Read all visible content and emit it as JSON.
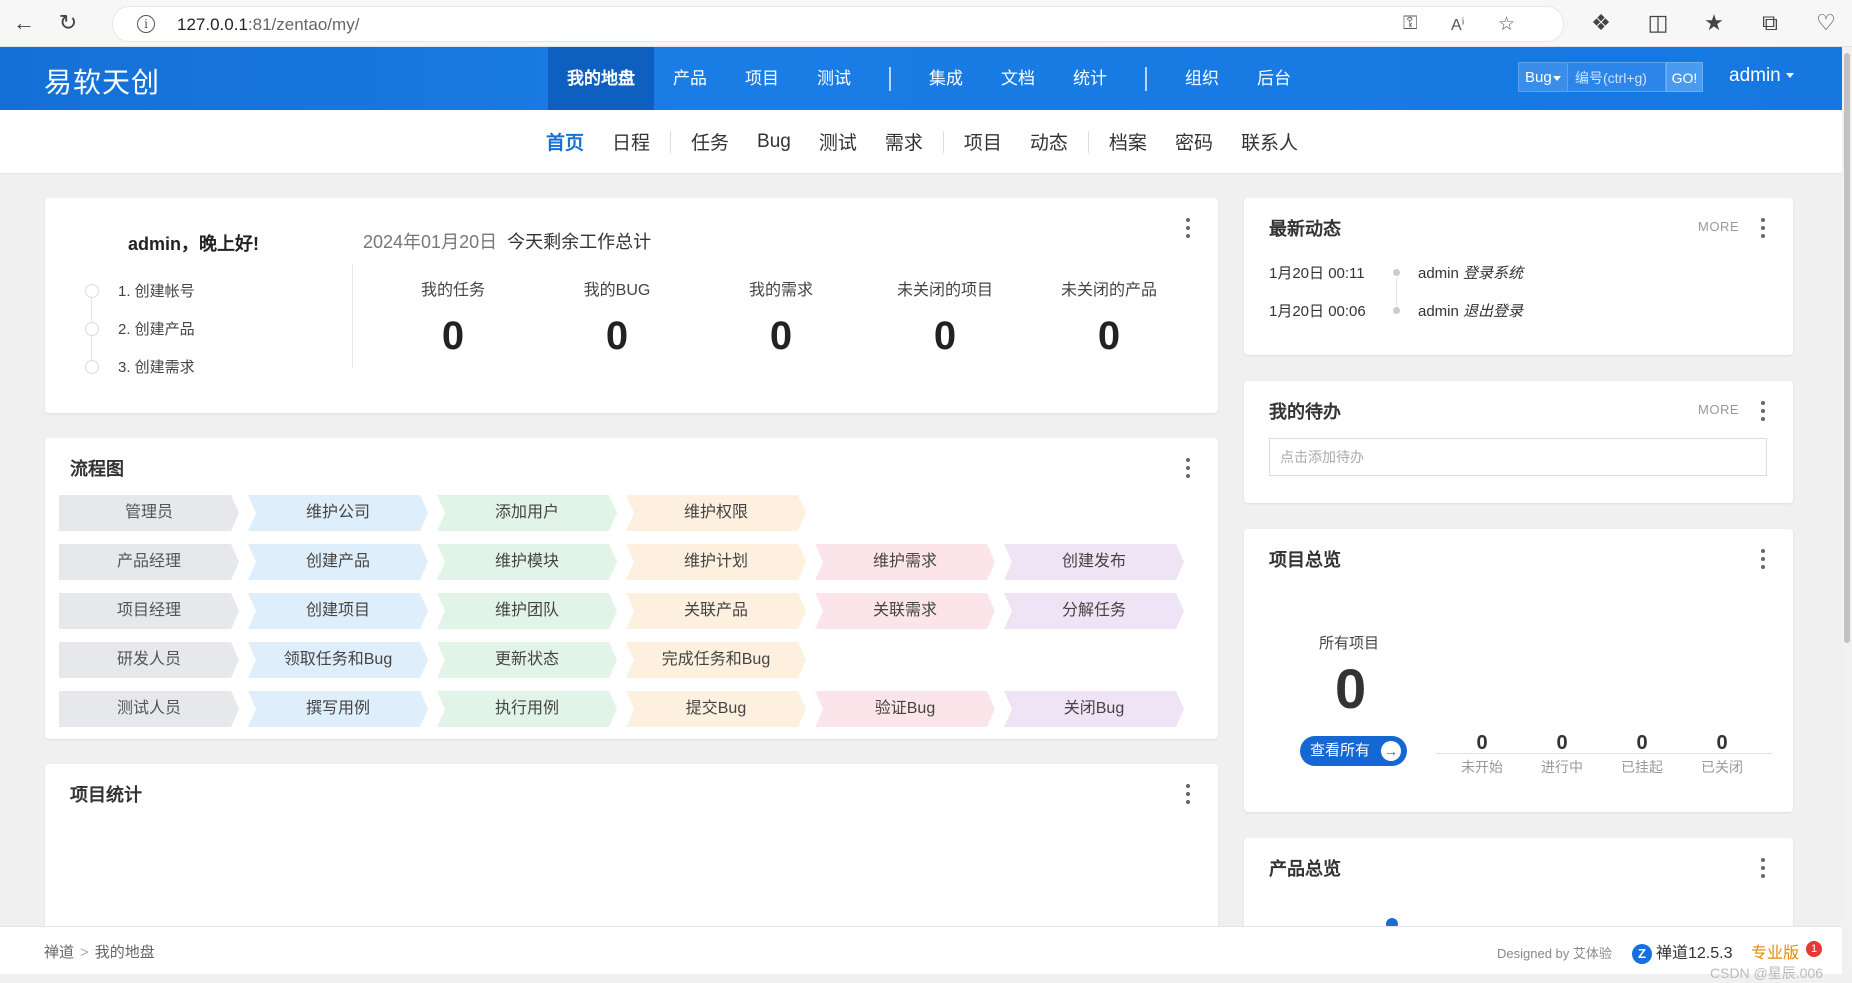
{
  "browser": {
    "url_host": "127.0.0.1",
    "url_rest": ":81/zentao/my/"
  },
  "topnav": {
    "logo": "易软天创",
    "items": [
      "我的地盘",
      "产品",
      "项目",
      "测试",
      "集成",
      "文档",
      "统计",
      "组织",
      "后台"
    ],
    "active": "我的地盘",
    "search_type": "Bug",
    "search_placeholder": "编号(ctrl+g)",
    "go_label": "GO!",
    "user": "admin"
  },
  "subnav": {
    "items": [
      "首页",
      "日程",
      "任务",
      "Bug",
      "测试",
      "需求",
      "项目",
      "动态",
      "档案",
      "密码",
      "联系人"
    ],
    "active": "首页"
  },
  "welcome": {
    "greeting": "admin，晚上好!",
    "steps": [
      "1. 创建帐号",
      "2. 创建产品",
      "3. 创建需求"
    ],
    "date": "2024年01月20日",
    "summary_title": "今天剩余工作总计",
    "stats": [
      {
        "label": "我的任务",
        "value": "0"
      },
      {
        "label": "我的BUG",
        "value": "0"
      },
      {
        "label": "我的需求",
        "value": "0"
      },
      {
        "label": "未关闭的项目",
        "value": "0"
      },
      {
        "label": "未关闭的产品",
        "value": "0"
      }
    ]
  },
  "flowchart": {
    "title": "流程图",
    "rows": [
      {
        "role": "管理员",
        "steps": [
          "维护公司",
          "添加用户",
          "维护权限"
        ]
      },
      {
        "role": "产品经理",
        "steps": [
          "创建产品",
          "维护模块",
          "维护计划",
          "维护需求",
          "创建发布"
        ]
      },
      {
        "role": "项目经理",
        "steps": [
          "创建项目",
          "维护团队",
          "关联产品",
          "关联需求",
          "分解任务"
        ]
      },
      {
        "role": "研发人员",
        "steps": [
          "领取任务和Bug",
          "更新状态",
          "完成任务和Bug"
        ]
      },
      {
        "role": "测试人员",
        "steps": [
          "撰写用例",
          "执行用例",
          "提交Bug",
          "验证Bug",
          "关闭Bug"
        ]
      }
    ]
  },
  "project_stats": {
    "title": "项目统计"
  },
  "latest_dynamics": {
    "title": "最新动态",
    "more": "MORE",
    "items": [
      {
        "time": "1月20日 00:11",
        "user": "admin",
        "action": "登录系统"
      },
      {
        "time": "1月20日 00:06",
        "user": "admin",
        "action": "退出登录"
      }
    ]
  },
  "todo": {
    "title": "我的待办",
    "more": "MORE",
    "placeholder": "点击添加待办"
  },
  "project_overview": {
    "title": "项目总览",
    "all_label": "所有项目",
    "all_count": "0",
    "view_all": "查看所有",
    "stats": [
      {
        "label": "未开始",
        "value": "0"
      },
      {
        "label": "进行中",
        "value": "0"
      },
      {
        "label": "已挂起",
        "value": "0"
      },
      {
        "label": "已关闭",
        "value": "0"
      }
    ]
  },
  "product_overview": {
    "title": "产品总览"
  },
  "footer": {
    "breadcrumb": [
      "禅道",
      "我的地盘"
    ],
    "designed_by": "Designed by 艾体验",
    "version": "禅道12.5.3",
    "edition": "专业版",
    "badge": "1",
    "watermark": "CSDN @星辰.006"
  },
  "colors": {
    "primary": "#1a7de6",
    "active_nav": "#0d5fc0",
    "link_active": "#1a6fd4"
  }
}
